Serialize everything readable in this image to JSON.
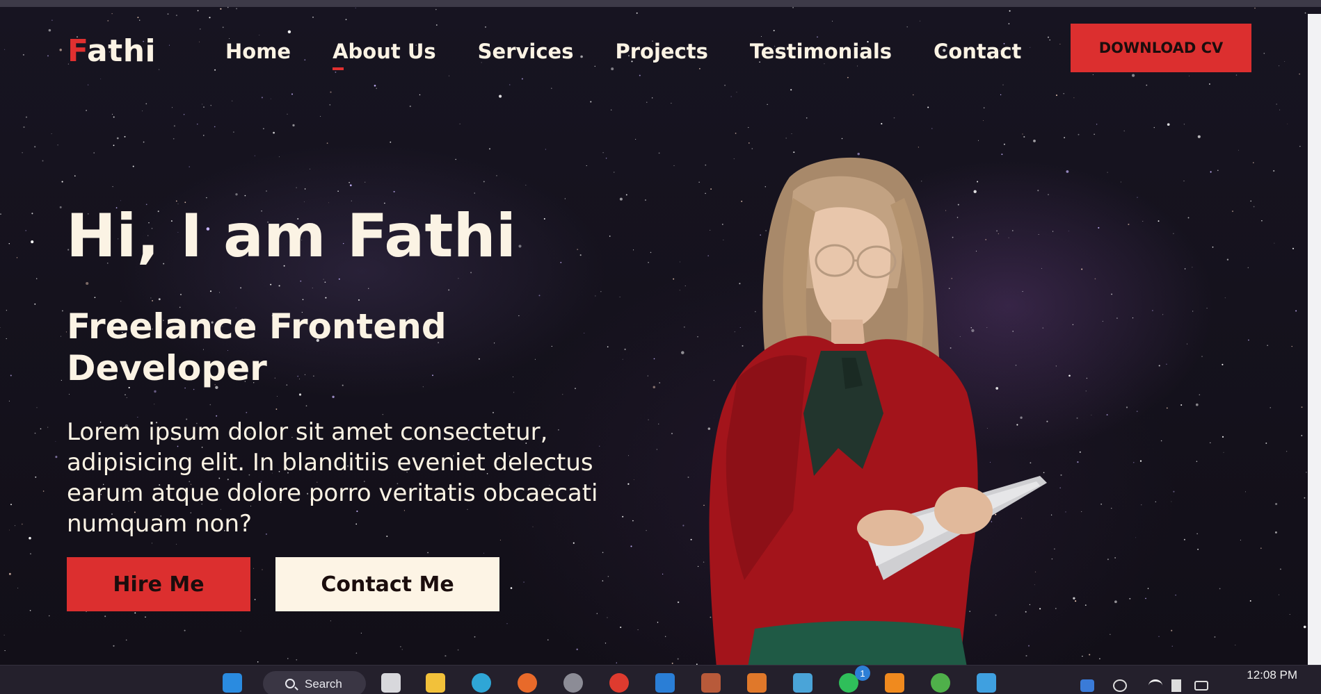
{
  "nav": {
    "logo_first": "F",
    "logo_rest": "athi",
    "items": [
      {
        "label": "Home"
      },
      {
        "label": "About Us",
        "active": true
      },
      {
        "label": "Services"
      },
      {
        "label": "Projects"
      },
      {
        "label": "Testimonials"
      },
      {
        "label": "Contact"
      }
    ],
    "download_label": "DOWNLOAD CV"
  },
  "hero": {
    "title": "Hi, I am Fathi",
    "subtitle": "Freelance Frontend Developer",
    "description": "Lorem ipsum dolor sit amet consectetur, adipisicing elit. In blanditiis eveniet delectus earum atque dolore porro veritatis obcaecati numquam non?",
    "hire_label": "Hire Me",
    "contact_label": "Contact Me"
  },
  "taskbar": {
    "search_label": "Search",
    "notification_badge": "1",
    "time": "12:08 PM",
    "apps": [
      "windows-start-icon",
      "task-view-icon",
      "file-explorer-icon",
      "edge-icon",
      "firefox-icon",
      "settings-icon",
      "chrome-icon",
      "vscode-icon",
      "notepad-icon",
      "xampp-icon",
      "app-icon",
      "whatsapp-icon",
      "vlc-icon",
      "paint-icon",
      "notepad-blue-icon"
    ]
  },
  "colors": {
    "accent": "#dc2f2f",
    "text": "#fbf3e4",
    "background": "#15121d"
  }
}
